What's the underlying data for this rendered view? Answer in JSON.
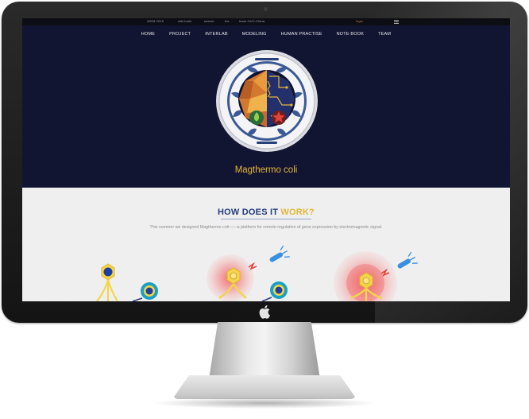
{
  "topbar": {
    "links": [
      "iGEM 2015",
      "wiki tools",
      "search",
      "fox",
      "team OUC-China"
    ],
    "login": "login"
  },
  "nav": {
    "items": [
      "HOME",
      "PROJECT",
      "INTERLAB",
      "MODELING",
      "HUMAN PRACTISE",
      "NOTE BOOK",
      "TEAM"
    ]
  },
  "hero": {
    "title": "Magthermo coli"
  },
  "section": {
    "heading_part1": "HOW DOES IT ",
    "heading_part2": "WORK?",
    "intro": "This summer we designed Magthermo coli——a platform for remote regulation of gene expression by electromagnetic signal."
  },
  "colors": {
    "hero_bg": "#121532",
    "accent_gold": "#e4b63a",
    "heading_blue": "#243c7c"
  }
}
